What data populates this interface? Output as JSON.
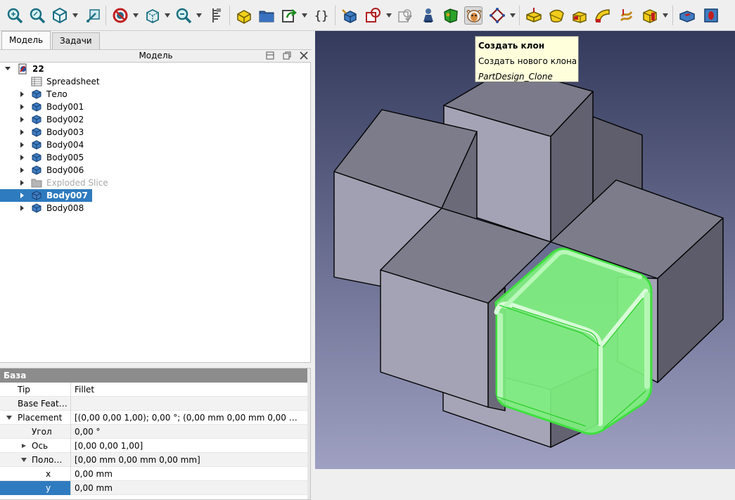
{
  "toolbar": {
    "icons": [
      "zoom-fit-all-icon",
      "zoom-selection-icon",
      "standard-views-icon",
      "measure-icon",
      "draw-style-icon",
      "bounding-box-icon",
      "zoom-icon",
      "measurement-clarify-icon",
      "create-part-icon",
      "create-group-icon",
      "link-icon",
      "macro-braces-icon",
      "create-body-icon",
      "sketch-icon",
      "validate-sketch-icon",
      "shape-binder-icon",
      "subshape-binder-icon",
      "clone-icon",
      "datum-plane-icon",
      "pad-icon",
      "revolution-icon",
      "loft-icon",
      "pipe-icon",
      "helix-icon",
      "additive-box-icon",
      "pocket-icon",
      "hole-icon"
    ]
  },
  "tabs": [
    {
      "label": "Модель",
      "active": true
    },
    {
      "label": "Задачи",
      "active": false
    }
  ],
  "model_header": {
    "title": "Модель"
  },
  "tree": {
    "root": {
      "label": "22"
    },
    "items": [
      {
        "label": "Spreadsheet",
        "icon": "spreadsheet-icon"
      },
      {
        "label": "Тело",
        "icon": "body-icon"
      },
      {
        "label": "Body001",
        "icon": "body-icon"
      },
      {
        "label": "Body002",
        "icon": "body-icon"
      },
      {
        "label": "Body003",
        "icon": "body-icon"
      },
      {
        "label": "Body004",
        "icon": "body-icon"
      },
      {
        "label": "Body005",
        "icon": "body-icon"
      },
      {
        "label": "Body006",
        "icon": "body-icon"
      },
      {
        "label": "Exploded Slice",
        "icon": "folder-icon"
      },
      {
        "label": "Body007",
        "icon": "body-icon"
      },
      {
        "label": "Body008",
        "icon": "body-icon"
      }
    ]
  },
  "properties": {
    "group": "База",
    "rows": [
      {
        "name": "Tip",
        "value": "Fillet"
      },
      {
        "name": "Base Feat…",
        "value": ""
      },
      {
        "name": "Placement",
        "value": "[(0,00 0,00 1,00); 0,00 °; (0,00 mm  0,00 mm  0,00 …"
      },
      {
        "name": "Угол",
        "value": "0,00 °"
      },
      {
        "name": "Ось",
        "value": "[0,00 0,00 1,00]"
      },
      {
        "name": "Поло…",
        "value": "[0,00 mm  0,00 mm  0,00 mm]"
      },
      {
        "name": "x",
        "value": "0,00 mm"
      },
      {
        "name": "y",
        "value": "0,00 mm"
      }
    ]
  },
  "tooltip": {
    "title": "Создать клон",
    "description": "Создать нового клона",
    "command": "PartDesign_Clone"
  },
  "colors": {
    "selection": "#2f7bbf",
    "highlight_green": "#5ef35e",
    "viewport_top": "#333a5c",
    "viewport_bottom": "#9fa0c2"
  }
}
